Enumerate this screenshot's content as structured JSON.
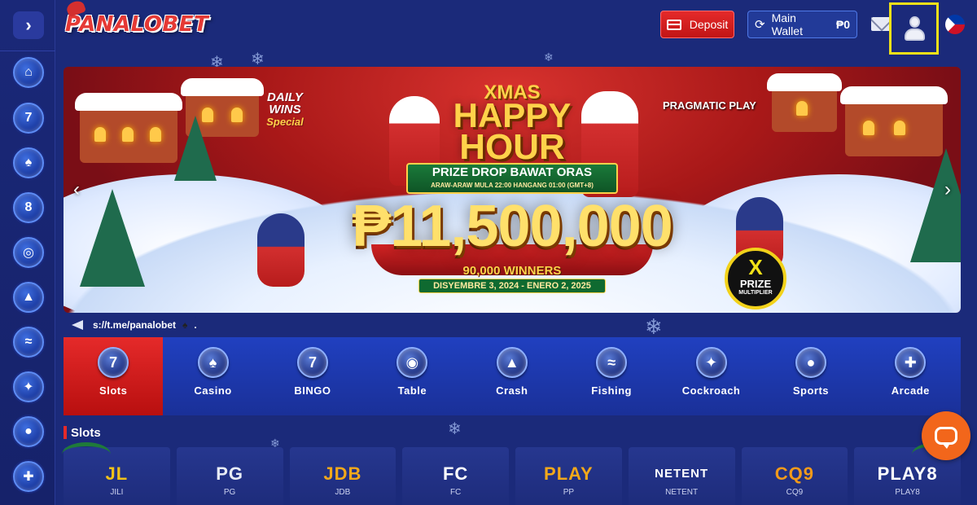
{
  "header": {
    "logo_text": "PANALOBET",
    "deposit_label": "Deposit",
    "wallet_label": "Main Wallet",
    "wallet_amount": "₱0"
  },
  "sidebar": {
    "toggle_glyph": "›",
    "items": [
      {
        "icon": "home-icon",
        "glyph": "⌂"
      },
      {
        "icon": "slots-777-icon",
        "glyph": "7"
      },
      {
        "icon": "casino-cards-icon",
        "glyph": "♠"
      },
      {
        "icon": "bingo-ball-icon",
        "glyph": "8"
      },
      {
        "icon": "table-game-icon",
        "glyph": "◎"
      },
      {
        "icon": "crash-rocket-icon",
        "glyph": "▲"
      },
      {
        "icon": "fishing-shark-icon",
        "glyph": "≈"
      },
      {
        "icon": "cockroach-icon",
        "glyph": "✦"
      },
      {
        "icon": "sports-ball-icon",
        "glyph": "●"
      },
      {
        "icon": "arcade-gamepad-icon",
        "glyph": "✚"
      }
    ]
  },
  "banner": {
    "daily_wins": "DAILY WINS",
    "special": "Special",
    "provider": "PRAGMATIC PLAY",
    "xmas": "XMAS",
    "happy": "HAPPY",
    "hour": "HOUR",
    "prize_drop": "PRIZE DROP BAWAT ORAS",
    "prize_sub": "ARAW-ARAW MULA 22:00 HANGANG 01:00 (GMT+8)",
    "amount": "₱11,500,000",
    "winners": "90,000 WINNERS",
    "dates": "DISYEMBRE 3, 2024 - ENERO 2, 2025",
    "x_label": "X",
    "prize_label": "PRIZE",
    "multiplier_label": "MULTIPLIER"
  },
  "marquee": {
    "text": "s://t.me/panalobet",
    "suffix": "."
  },
  "categories": [
    {
      "label": "Slots",
      "glyph": "7",
      "active": true
    },
    {
      "label": "Casino",
      "glyph": "♠",
      "active": false
    },
    {
      "label": "BINGO",
      "glyph": "7",
      "active": false
    },
    {
      "label": "Table",
      "glyph": "◉",
      "active": false
    },
    {
      "label": "Crash",
      "glyph": "▲",
      "active": false
    },
    {
      "label": "Fishing",
      "glyph": "≈",
      "active": false
    },
    {
      "label": "Cockroach",
      "glyph": "✦",
      "active": false
    },
    {
      "label": "Sports",
      "glyph": "●",
      "active": false
    },
    {
      "label": "Arcade",
      "glyph": "✚",
      "active": false
    }
  ],
  "slots_section": {
    "title": "Slots",
    "providers": [
      {
        "logo": "JL",
        "name": "JILI",
        "color": "#f2c218"
      },
      {
        "logo": "PG",
        "name": "PG",
        "color": "#e8ecf5"
      },
      {
        "logo": "JDB",
        "name": "JDB",
        "color": "#f2a81a"
      },
      {
        "logo": "FC",
        "name": "FC",
        "color": "#ffffff"
      },
      {
        "logo": "PLAY",
        "name": "PP",
        "color": "#f2a81a"
      },
      {
        "logo": "NETENT",
        "name": "NETENT",
        "color": "#ffffff"
      },
      {
        "logo": "CQ9",
        "name": "CQ9",
        "color": "#f29a1a"
      },
      {
        "logo": "PLAY8",
        "name": "PLAY8",
        "color": "#ffffff"
      }
    ]
  },
  "colors": {
    "background": "#1b2a7a",
    "accent_red": "#e52a2a",
    "highlight_yellow": "#f2e118",
    "chat_orange": "#f2661b"
  }
}
